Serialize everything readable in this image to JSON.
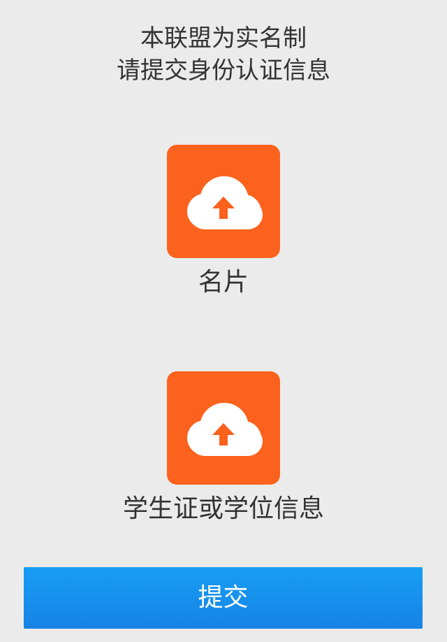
{
  "header": {
    "line1": "本联盟为实名制",
    "line2": "请提交身份认证信息"
  },
  "uploads": [
    {
      "label": "名片",
      "icon": "cloud-upload-icon"
    },
    {
      "label": "学生证或学位信息",
      "icon": "cloud-upload-icon"
    }
  ],
  "submit": {
    "label": "提交"
  },
  "colors": {
    "background": "#ebebeb",
    "tile": "#fb621d",
    "button_top": "#179ef4",
    "button_bottom": "#1783e5",
    "text": "#333333"
  }
}
